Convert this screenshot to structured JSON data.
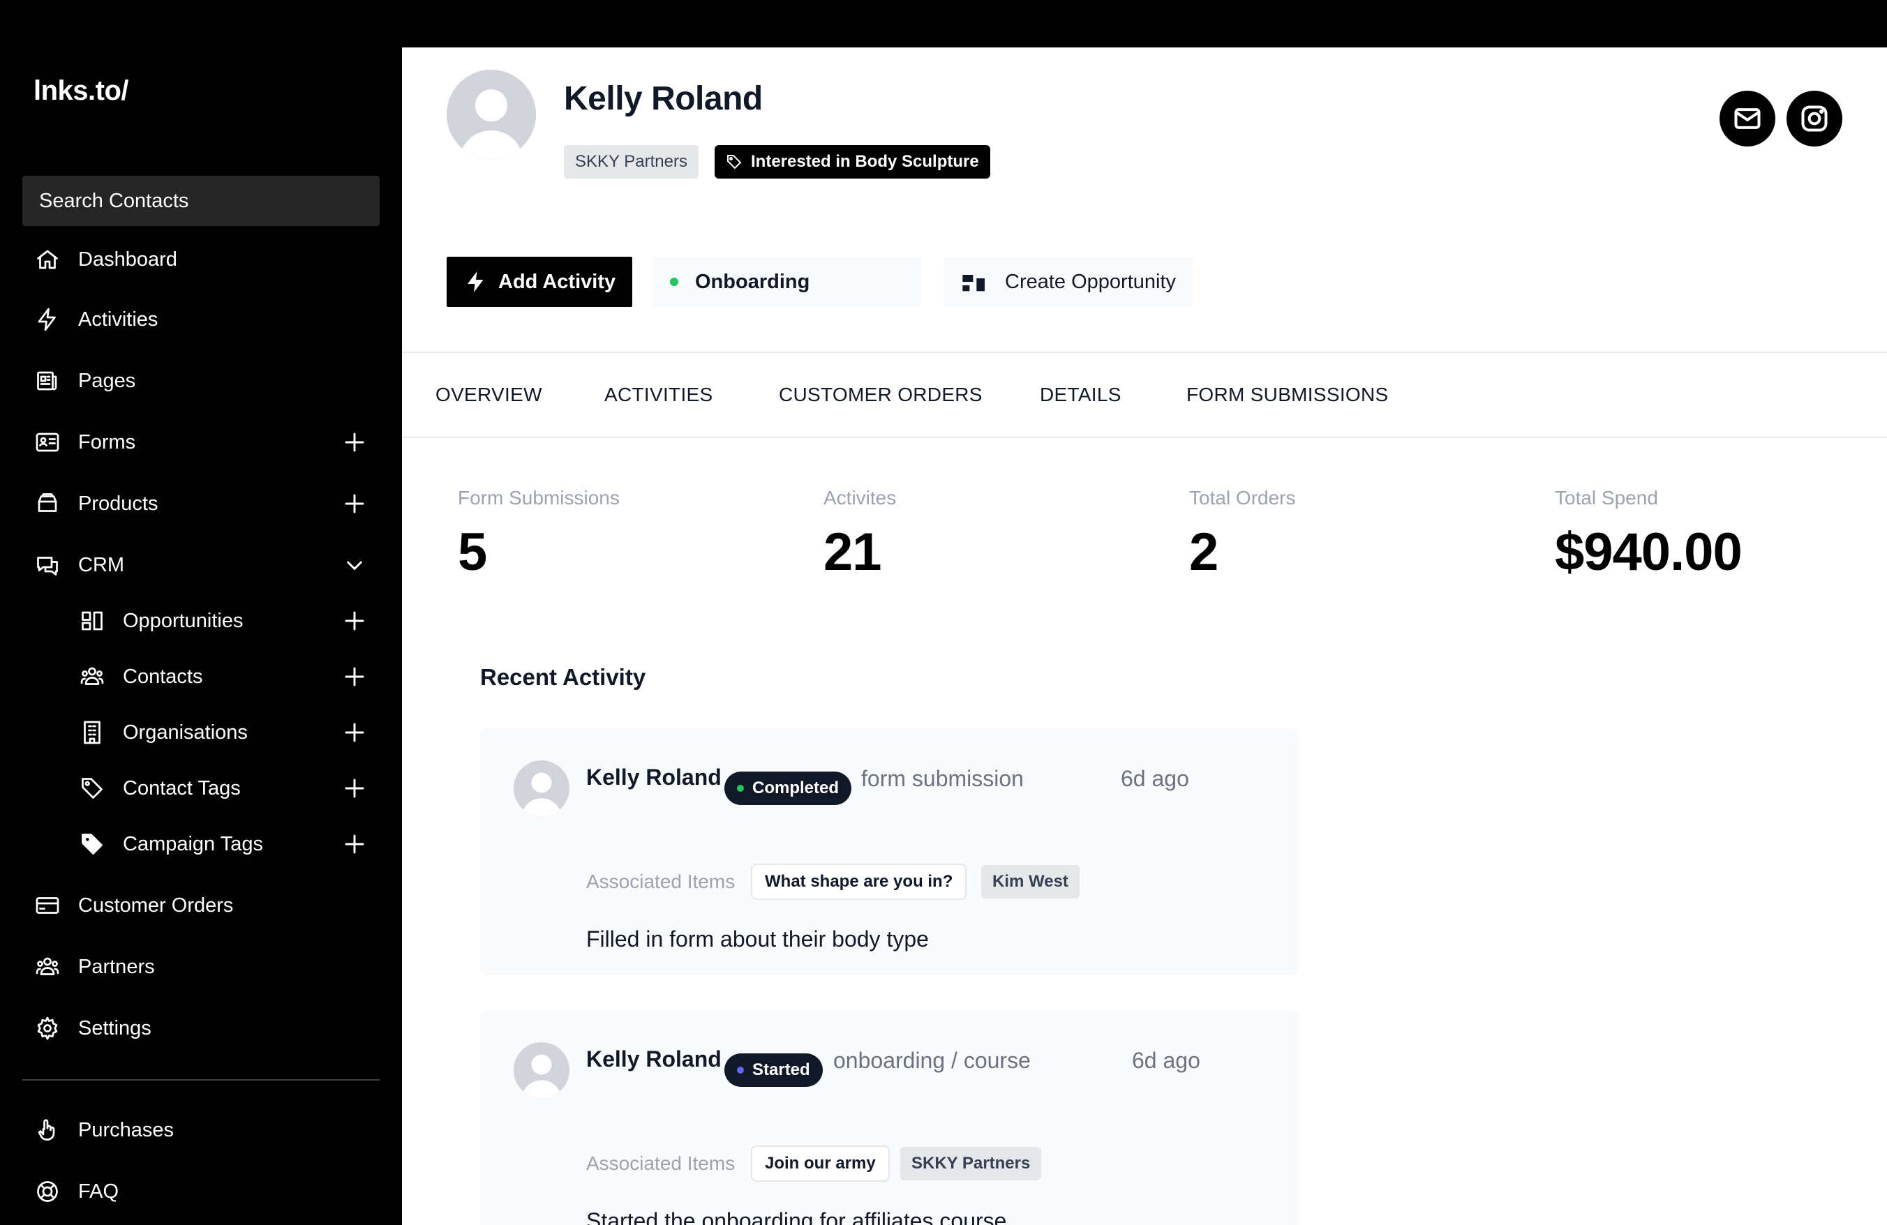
{
  "app": {
    "logo": "lnks.to/"
  },
  "sidebar": {
    "search_label": "Search Contacts",
    "items": [
      {
        "label": "Dashboard",
        "icon": "home-icon"
      },
      {
        "label": "Activities",
        "icon": "bolt-icon"
      },
      {
        "label": "Pages",
        "icon": "newspaper-icon"
      },
      {
        "label": "Forms",
        "icon": "id-card-icon"
      },
      {
        "label": "Products",
        "icon": "box-icon"
      },
      {
        "label": "CRM",
        "icon": "chat-bubbles-icon"
      },
      {
        "label": "Opportunities",
        "icon": "kanban-icon"
      },
      {
        "label": "Contacts",
        "icon": "users-icon"
      },
      {
        "label": "Organisations",
        "icon": "building-icon"
      },
      {
        "label": "Contact Tags",
        "icon": "tag-outline-icon"
      },
      {
        "label": "Campaign Tags",
        "icon": "tag-filled-icon"
      },
      {
        "label": "Customer Orders",
        "icon": "credit-card-icon"
      },
      {
        "label": "Partners",
        "icon": "users-icon"
      },
      {
        "label": "Settings",
        "icon": "gear-icon"
      },
      {
        "label": "Purchases",
        "icon": "hand-icon"
      },
      {
        "label": "FAQ",
        "icon": "lifebuoy-icon"
      }
    ]
  },
  "contact": {
    "name": "Kelly Roland",
    "tags": [
      "SKKY Partners",
      "Interested in Body Sculpture"
    ]
  },
  "actions": {
    "add_activity": "Add Activity",
    "status": "Onboarding",
    "status_color": "#22c55e",
    "create_opportunity": "Create Opportunity"
  },
  "tabs": [
    "OVERVIEW",
    "ACTIVITIES",
    "CUSTOMER ORDERS",
    "DETAILS",
    "FORM SUBMISSIONS"
  ],
  "stats": [
    {
      "label": "Form Submissions",
      "value": "5"
    },
    {
      "label": "Activites",
      "value": "21"
    },
    {
      "label": "Total Orders",
      "value": "2"
    },
    {
      "label": "Total Spend",
      "value": "$940.00"
    }
  ],
  "recent_activity": {
    "title": "Recent Activity",
    "assoc_label": "Associated Items",
    "items": [
      {
        "name": "Kelly Roland",
        "status": "Completed",
        "status_dot": "#22c55e",
        "type": "form submission",
        "time": "6d ago",
        "chips": [
          "What shape are you in?",
          "Kim West"
        ],
        "description": "Filled in form about their body type"
      },
      {
        "name": "Kelly Roland",
        "status": "Started",
        "status_dot": "#6366f1",
        "type": "onboarding / course",
        "time": "6d ago",
        "chips": [
          "Join our army",
          "SKKY Partners"
        ],
        "description": "Started the onboarding for affiliates course"
      }
    ]
  }
}
